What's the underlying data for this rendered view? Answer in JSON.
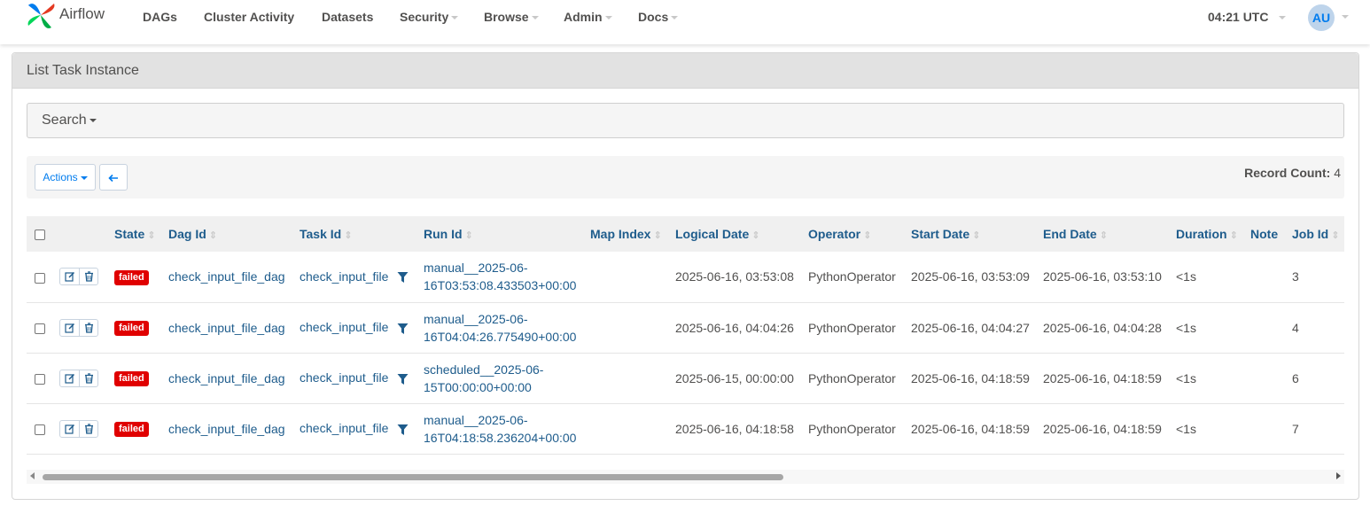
{
  "navbar": {
    "brand": "Airflow",
    "items": [
      {
        "label": "DAGs"
      },
      {
        "label": "Cluster Activity"
      },
      {
        "label": "Datasets"
      },
      {
        "label": "Security"
      },
      {
        "label": "Browse"
      },
      {
        "label": "Admin"
      },
      {
        "label": "Docs"
      }
    ],
    "clock": "04:21 UTC",
    "user_initials": "AU"
  },
  "panel": {
    "title": "List Task Instance",
    "search_label": "Search",
    "actions_label": "Actions",
    "record_count_label": "Record Count:",
    "record_count": "4"
  },
  "table": {
    "headers": [
      "State",
      "Dag Id",
      "Task Id",
      "Run Id",
      "Map Index",
      "Logical Date",
      "Operator",
      "Start Date",
      "End Date",
      "Duration",
      "Note",
      "Job Id"
    ],
    "rows": [
      {
        "state": "failed",
        "dag_id": "check_input_file_dag",
        "task_id": "check_input_file",
        "run_id_1": "manual__2025-06-",
        "run_id_2": "16T03:53:08.433503+00:00",
        "map_index": "",
        "logical_date": "2025-06-16, 03:53:08",
        "operator": "PythonOperator",
        "start_date": "2025-06-16, 03:53:09",
        "end_date": "2025-06-16, 03:53:10",
        "duration": "<1s",
        "note": "",
        "job_id": "3"
      },
      {
        "state": "failed",
        "dag_id": "check_input_file_dag",
        "task_id": "check_input_file",
        "run_id_1": "manual__2025-06-",
        "run_id_2": "16T04:04:26.775490+00:00",
        "map_index": "",
        "logical_date": "2025-06-16, 04:04:26",
        "operator": "PythonOperator",
        "start_date": "2025-06-16, 04:04:27",
        "end_date": "2025-06-16, 04:04:28",
        "duration": "<1s",
        "note": "",
        "job_id": "4"
      },
      {
        "state": "failed",
        "dag_id": "check_input_file_dag",
        "task_id": "check_input_file",
        "run_id_1": "scheduled__2025-06-",
        "run_id_2": "15T00:00:00+00:00",
        "map_index": "",
        "logical_date": "2025-06-15, 00:00:00",
        "operator": "PythonOperator",
        "start_date": "2025-06-16, 04:18:59",
        "end_date": "2025-06-16, 04:18:59",
        "duration": "<1s",
        "note": "",
        "job_id": "6"
      },
      {
        "state": "failed",
        "dag_id": "check_input_file_dag",
        "task_id": "check_input_file",
        "run_id_1": "manual__2025-06-",
        "run_id_2": "16T04:18:58.236204+00:00",
        "map_index": "",
        "logical_date": "2025-06-16, 04:18:58",
        "operator": "PythonOperator",
        "start_date": "2025-06-16, 04:18:59",
        "end_date": "2025-06-16, 04:18:59",
        "duration": "<1s",
        "note": "",
        "job_id": "7"
      }
    ]
  },
  "colors": {
    "accent": "#017cee",
    "link": "#1e5c8c",
    "failed": "#e00000"
  },
  "icons": [
    "airflow-logo",
    "chevron-down-icon",
    "arrow-left-icon",
    "sort-icon",
    "edit-icon",
    "trash-icon",
    "filter-icon"
  ]
}
